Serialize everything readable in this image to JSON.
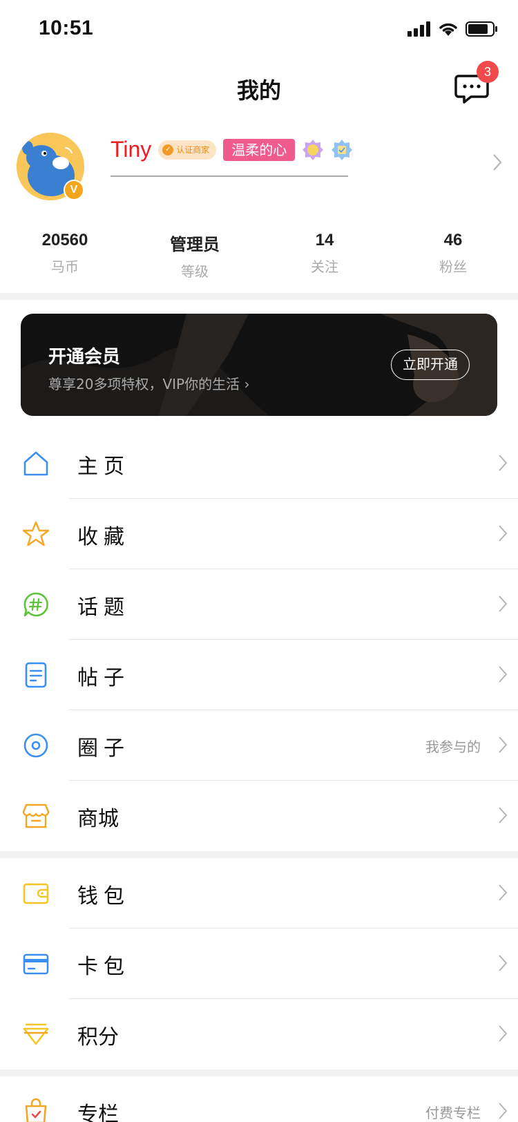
{
  "status_bar": {
    "time": "10:51"
  },
  "nav": {
    "title": "我的",
    "message_badge": "3"
  },
  "profile": {
    "username": "Tiny",
    "cert_label": "认证商家",
    "title_badge": "温柔的心",
    "avatar_badge": "V"
  },
  "stats": [
    {
      "value": "20560",
      "label": "马币"
    },
    {
      "value": "管理员",
      "label": "等级"
    },
    {
      "value": "14",
      "label": "关注"
    },
    {
      "value": "46",
      "label": "粉丝"
    }
  ],
  "vip": {
    "title": "开通会员",
    "subtitle": "尊享20多项特权，VIP你的生活 ›",
    "button": "立即开通"
  },
  "menu_group_1": [
    {
      "label": "主页",
      "icon": "home-icon",
      "extra": ""
    },
    {
      "label": "收藏",
      "icon": "star-icon",
      "extra": ""
    },
    {
      "label": "话题",
      "icon": "topic-hash-icon",
      "extra": ""
    },
    {
      "label": "帖子",
      "icon": "document-icon",
      "extra": ""
    },
    {
      "label": "圈子",
      "icon": "circle-icon",
      "extra": "我参与的"
    },
    {
      "label": "商城",
      "icon": "store-icon",
      "extra": ""
    }
  ],
  "menu_group_2": [
    {
      "label": "钱包",
      "icon": "wallet-icon",
      "extra": ""
    },
    {
      "label": "卡包",
      "icon": "card-icon",
      "extra": ""
    },
    {
      "label": "积分",
      "icon": "points-icon",
      "extra": ""
    }
  ],
  "menu_group_3": [
    {
      "label": "专栏",
      "icon": "column-bag-icon",
      "extra": "付费专栏"
    }
  ],
  "colors": {
    "accent_blue": "#3b8ff3",
    "accent_orange": "#f5a623",
    "accent_green": "#5ec33a",
    "badge_red": "#f04a4a",
    "username_red": "#ee1d24"
  }
}
